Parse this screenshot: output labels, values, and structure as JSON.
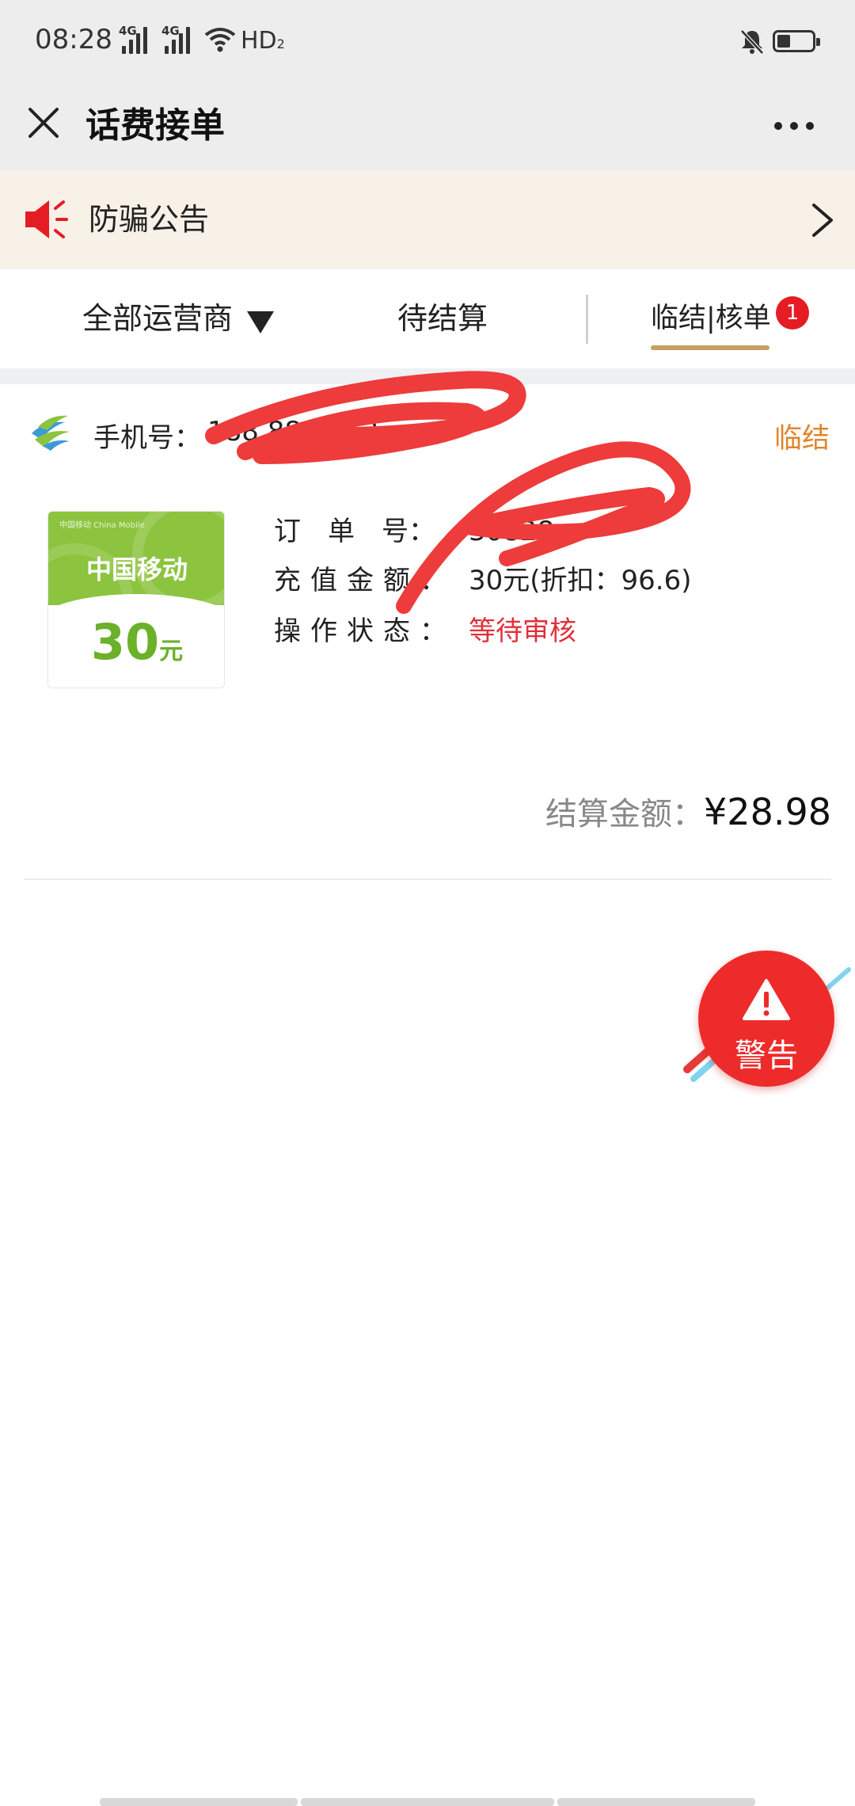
{
  "status_bar": {
    "time": "08:28",
    "net1": "4G",
    "net2": "4G",
    "hd": "HD",
    "hd_sub": "2"
  },
  "nav": {
    "title": "话费接单"
  },
  "notice": {
    "text": "防骗公告"
  },
  "tabs": {
    "all": "全部运营商",
    "pending": "待结算",
    "active": "临结|核单",
    "badge": "1"
  },
  "order": {
    "phone_label": "手机号：",
    "phone_value": "188 880 113",
    "status_tag": "临结",
    "tile": {
      "brand": "中国移动",
      "amount": "30",
      "unit": "元",
      "brand_small": "中国移动 China Mobile"
    },
    "fields": [
      {
        "label": "订　单　号：",
        "value": "30828"
      },
      {
        "label": "充值金额：",
        "value": "30元(折扣：96.6)"
      },
      {
        "label": "操作状态：",
        "value": "等待审核"
      }
    ],
    "settle_label": "结算金额：",
    "settle_amount": "¥28.98"
  },
  "fab": {
    "label": "警告"
  },
  "colors": {
    "accent": "#c8a063",
    "status_orange": "#e1842b",
    "red": "#e0303a",
    "mobile_green": "#8cc43f"
  }
}
